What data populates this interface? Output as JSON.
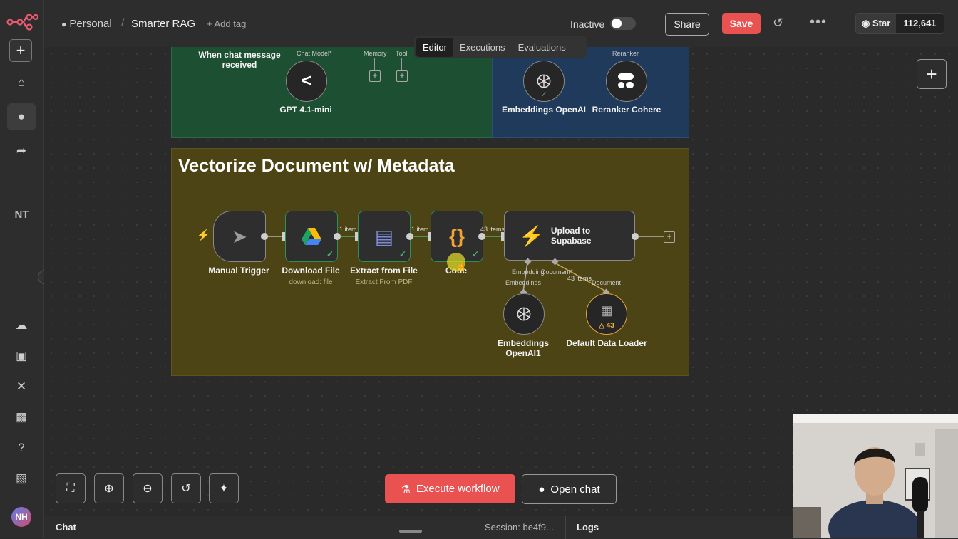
{
  "topbar": {
    "breadcrumb_personal": "Personal",
    "workflow_title": "Smarter RAG",
    "add_tag": "+ Add tag",
    "status_label": "Inactive",
    "share_label": "Share",
    "save_label": "Save",
    "github_star": "Star",
    "github_count": "112,641"
  },
  "tabs": [
    {
      "label": "Editor"
    },
    {
      "label": "Executions"
    },
    {
      "label": "Evaluations"
    }
  ],
  "sidebar": {
    "project_initials": "NT",
    "user_initials": "NH"
  },
  "top_groups": {
    "chat_trigger_label": "When chat message received",
    "chat_model_label": "Chat Model*",
    "memory_label": "Memory",
    "tool_label": "Tool",
    "gpt_label": "GPT 4.1-mini",
    "reranker_port_label": "Reranker",
    "embeddings_label": "Embeddings OpenAI",
    "reranker_label": "Reranker Cohere"
  },
  "vector_group": {
    "title": "Vectorize Document w/ Metadata",
    "manual_trigger": "Manual Trigger",
    "download_file": "Download File",
    "download_sub": "download: file",
    "extract_file": "Extract from File",
    "extract_sub": "Extract From PDF",
    "code": "Code",
    "upload_line1": "Upload to",
    "upload_line2": "Supabase",
    "edge1": "1 item",
    "edge2": "1 item",
    "edge3": "43 items",
    "embedding_port": "Embedding",
    "document_port": "Document*",
    "edge4": "43 items",
    "embeddings_port_label": "Embeddings",
    "document_port_label": "Document",
    "embeddings1_line1": "Embeddings",
    "embeddings1_line2": "OpenAI1",
    "loader": "Default Data Loader",
    "loader_warn": "43"
  },
  "bottom": {
    "execute_label": "Execute workflow",
    "open_chat_label": "Open chat",
    "chat_tab": "Chat",
    "session": "Session: be4f9...",
    "logs_tab": "Logs"
  },
  "colors": {
    "accent_red": "#ea5252",
    "green_group": "#1d4f32",
    "blue_group": "#1f3a5a",
    "olive_group": "#4d4416"
  }
}
